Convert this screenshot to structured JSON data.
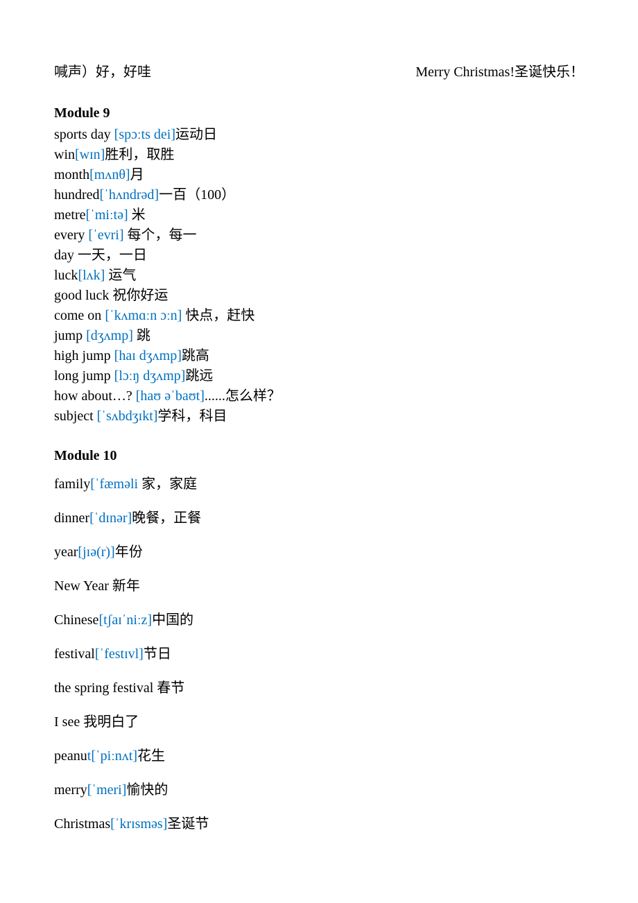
{
  "top": {
    "left": "喊声）好，好哇",
    "right": "Merry Christmas!圣诞快乐！"
  },
  "module9": {
    "heading": "Module 9",
    "entries": [
      {
        "word": "sports day ",
        "phon": "[spɔːts   dei]",
        "def": "运动日"
      },
      {
        "word": "win",
        "phon": "[wɪn]",
        "def": "胜利，取胜"
      },
      {
        "word": "month",
        "phon": "[mʌnθ]",
        "def": "月"
      },
      {
        "word": "hundred",
        "phon": "[ˈhʌndrəd]",
        "def": "一百（100）"
      },
      {
        "word": "metre",
        "phon": "[ˈmiːtə]",
        "def": " 米"
      },
      {
        "word": "every ",
        "phon": "[ˈevri]",
        "def": " 每个，每一"
      },
      {
        "word": "day 一天，一日",
        "phon": "",
        "def": ""
      },
      {
        "word": "luck",
        "phon": "[lʌk]",
        "def": " 运气"
      },
      {
        "word": "good luck 祝你好运",
        "phon": "",
        "def": ""
      },
      {
        "word": "come on ",
        "phon": "[ˈkʌmɑːn   ɔːn]",
        "def": " 快点，赶快"
      },
      {
        "word": "jump ",
        "phon": "[dʒʌmp]",
        "def": " 跳"
      },
      {
        "word": "high jump ",
        "phon": "[haɪ dʒʌmp]",
        "def": "跳高"
      },
      {
        "word": "long jump ",
        "phon": "[lɔːŋ dʒʌmp]",
        "def": "跳远"
      },
      {
        "word": "how about…? ",
        "phon": "[haʊ əˈbaʊt]",
        "def": "......怎么样？"
      },
      {
        "word": "subject ",
        "phon": "[ˈsʌbdʒɪkt]",
        "def": "学科，科目"
      }
    ]
  },
  "module10": {
    "heading": "Module 10",
    "entries": [
      {
        "word": "family",
        "phon": "[ˈfæməli",
        "def": " 家，家庭"
      },
      {
        "word": "dinner",
        "phon": "[ˈdɪnər]",
        "def": "晚餐，正餐"
      },
      {
        "word": "year",
        "phon": "[jɪə(r)]",
        "def": "年份"
      },
      {
        "word": "New Year 新年",
        "phon": "",
        "def": ""
      },
      {
        "word": "Chinese",
        "phon": "[tʃaɪˈniːz]",
        "def": "中国的"
      },
      {
        "word": "festival",
        "phon": "[ˈfestɪvl]",
        "def": "节日"
      },
      {
        "word": "the spring festival 春节",
        "phon": "",
        "def": ""
      },
      {
        "word": "I see 我明白了",
        "phon": "",
        "def": ""
      },
      {
        "word": "peanu",
        "phon": "t[ˈpiːnʌt]",
        "def": "花生"
      },
      {
        "word": "merry",
        "phon": "[ˈmeri]",
        "def": "愉快的"
      },
      {
        "word": "Christmas",
        "phon": "[ˈkrɪsməs]",
        "def": "圣诞节"
      }
    ]
  }
}
